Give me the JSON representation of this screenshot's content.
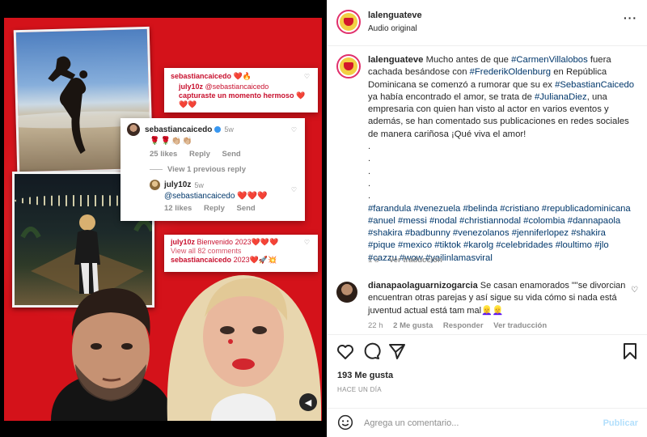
{
  "colors": {
    "frame_red": "#d4121a",
    "link": "#00376b",
    "muted": "#8e8e8e",
    "post_disabled": "#b2dffc"
  },
  "media": {
    "card1": {
      "user": "sebastiancaicedo",
      "user_emoji": "❤️🔥",
      "reply_user": "july10z",
      "reply_mention": "@sebastiancaicedo",
      "reply_text": "capturaste un momento hermoso",
      "reply_emoji": "❤️",
      "reply_emoji_line2": "❤️❤️"
    },
    "card2": {
      "user": "sebastiancaicedo",
      "time": "5w",
      "emoji": "🌹🌹👏🏼👏🏼",
      "likes": "25 likes",
      "reply": "Reply",
      "send": "Send",
      "view_previous": "View 1 previous reply",
      "reply_user": "july10z",
      "reply_time": "5w",
      "reply_mention": "@sebastiancaicedo",
      "reply_emoji": "❤️❤️❤️",
      "reply_likes": "12 likes",
      "reply_reply": "Reply",
      "reply_send": "Send"
    },
    "card3": {
      "line1_user": "july10z",
      "line1_text": "Bienvenido 2023❤️❤️❤️",
      "view_all": "View all 82 comments",
      "line3_user": "sebastiancaicedo",
      "line3_text": "2023❤️🚀💥"
    },
    "mute_icon": "speaker-icon"
  },
  "header": {
    "username": "lalenguateve",
    "audio": "Audio original",
    "more_icon": "more-icon"
  },
  "caption": {
    "username": "lalenguateve",
    "p1": "Mucho antes de que ",
    "m1": "#CarmenVillalobos",
    "p2": " fuera cachada besándose con ",
    "m2": "#FrederikOldenburg",
    "p3": " en República Dominicana se comenzó a rumorar que su ex ",
    "m3": "#SebastianCaicedo",
    "p4": " ya había encontrado el amor, se trata de ",
    "m4": "#JulianaDiez",
    "p5": ", una empresaria con quien han visto al actor en varios eventos y además, se han comentado sus publicaciones en redes sociales de manera cariñosa ¡Qué viva el amor!",
    "dots": [
      ".",
      ".",
      ".",
      ".",
      "."
    ],
    "hashtags": "#farandula #venezuela #belinda #cristiano #republicadominicana #anuel #messi #nodal #christiannodal #colombia #dannapaola #shakira #badbunny #venezolanos #jenniferlopez #shakira #pique #mexico #tiktok #karolg #celebridades #loultimo #jlo #cazzu #wow #yailinlamasviral",
    "time": "1 d",
    "translate": "Ver traducción"
  },
  "comment": {
    "username": "dianapaolaguarnizogarcia",
    "text": "Se casan enamorados \"\"se divorcian encuentran otras parejas y así sigue su vida cómo si nada está juventud actual está tam mal👱‍♀️👱‍♀️",
    "time": "22 h",
    "likes": "2 Me gusta",
    "reply": "Responder",
    "translate": "Ver traducción"
  },
  "actions": {
    "likes": "193 Me gusta",
    "ago": "HACE UN DÍA"
  },
  "compose": {
    "placeholder": "Agrega un comentario...",
    "post": "Publicar"
  }
}
